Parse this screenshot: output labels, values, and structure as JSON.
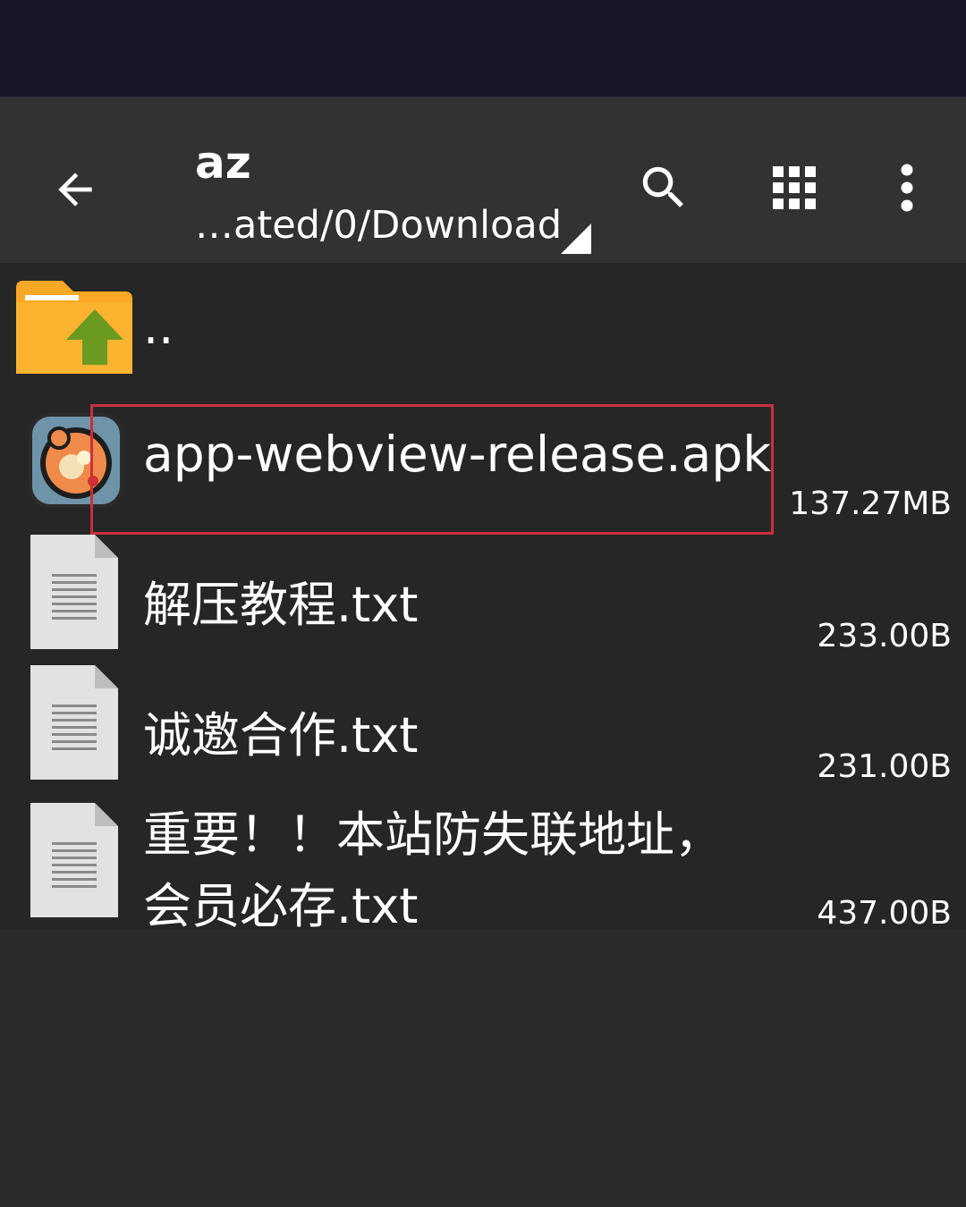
{
  "toolbar": {
    "title": "az",
    "path": "…ated/0/Download"
  },
  "icons": {
    "back": "arrow-back-icon",
    "search": "search-icon",
    "grid": "grid-view-icon",
    "more": "more-vert-icon"
  },
  "files": {
    "parent": {
      "name": ".."
    },
    "items": [
      {
        "name": "app-webview-release.apk",
        "size": "137.27MB",
        "type": "apk"
      },
      {
        "name": "解压教程.txt",
        "size": "233.00B",
        "type": "txt"
      },
      {
        "name": "诚邀合作.txt",
        "size": "231.00B",
        "type": "txt"
      },
      {
        "name_line1": "重要！！本站防失联地址，",
        "name_line2": "会员必存.txt",
        "size": "437.00B",
        "type": "txt"
      }
    ]
  },
  "colors": {
    "status_bar": "#1a1427",
    "toolbar": "#323232",
    "list_bg": "#262626",
    "page_bg": "#2b2b2b",
    "folder": "#f9a825",
    "folder_arrow": "#6a9a1f",
    "highlight": "#cc2f3a"
  }
}
